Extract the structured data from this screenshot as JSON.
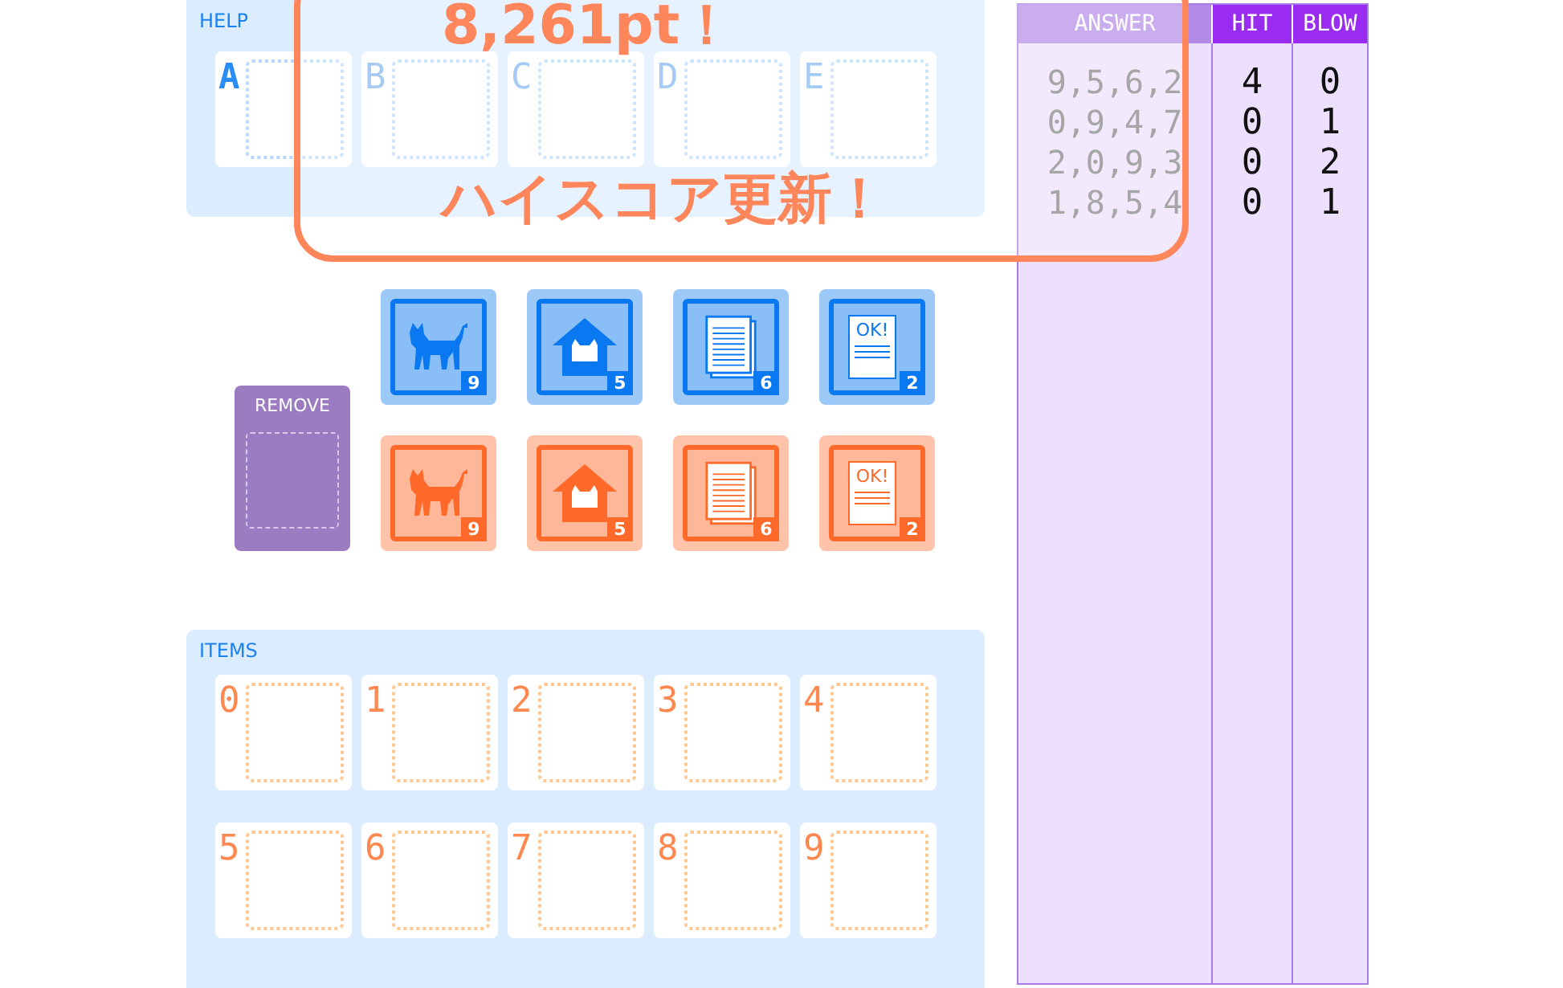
{
  "help": {
    "title": "HELP",
    "slots": [
      {
        "letter": "A",
        "active": true
      },
      {
        "letter": "B",
        "active": false
      },
      {
        "letter": "C",
        "active": false
      },
      {
        "letter": "D",
        "active": false
      },
      {
        "letter": "E",
        "active": false
      }
    ]
  },
  "remove": {
    "label": "REMOVE"
  },
  "tile_rows": [
    {
      "color": "#0a78f0",
      "tiles": [
        {
          "kind": "cat",
          "count": "9"
        },
        {
          "kind": "house",
          "count": "5"
        },
        {
          "kind": "document",
          "count": "6"
        },
        {
          "kind": "approval",
          "label": "OK!",
          "count": "2"
        }
      ]
    },
    {
      "color": "#ff6a2a",
      "tiles": [
        {
          "kind": "cat",
          "count": "9"
        },
        {
          "kind": "house",
          "count": "5"
        },
        {
          "kind": "document",
          "count": "6"
        },
        {
          "kind": "approval",
          "label": "OK!",
          "count": "2"
        }
      ]
    }
  ],
  "items": {
    "title": "ITEMS",
    "slots": [
      "0",
      "1",
      "2",
      "3",
      "4",
      "5",
      "6",
      "7",
      "8",
      "9"
    ]
  },
  "table": {
    "columns": [
      "ANSWER",
      "HIT",
      "BLOW"
    ],
    "rows": [
      {
        "answer": "9,5,6,2",
        "hit": "4",
        "blow": "0"
      },
      {
        "answer": "0,9,4,7",
        "hit": "0",
        "blow": "1"
      },
      {
        "answer": "2,0,9,3",
        "hit": "0",
        "blow": "2"
      },
      {
        "answer": "1,8,5,4",
        "hit": "0",
        "blow": "1"
      }
    ]
  },
  "popup": {
    "lines": [
      "8,261pt！",
      "ハイスコア更新！"
    ]
  }
}
